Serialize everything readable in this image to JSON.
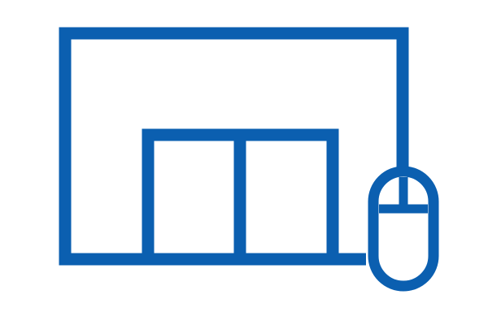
{
  "icon": {
    "name": "desktop-window-with-mouse-icon",
    "color": "#0b5fb0",
    "background": "#ffffff",
    "parts": [
      "screen-frame-icon",
      "window-frame-icon",
      "window-left-pane-icon",
      "window-right-pane-icon",
      "mouse-cable-icon",
      "mouse-icon",
      "mouse-button-divider-icon"
    ]
  }
}
